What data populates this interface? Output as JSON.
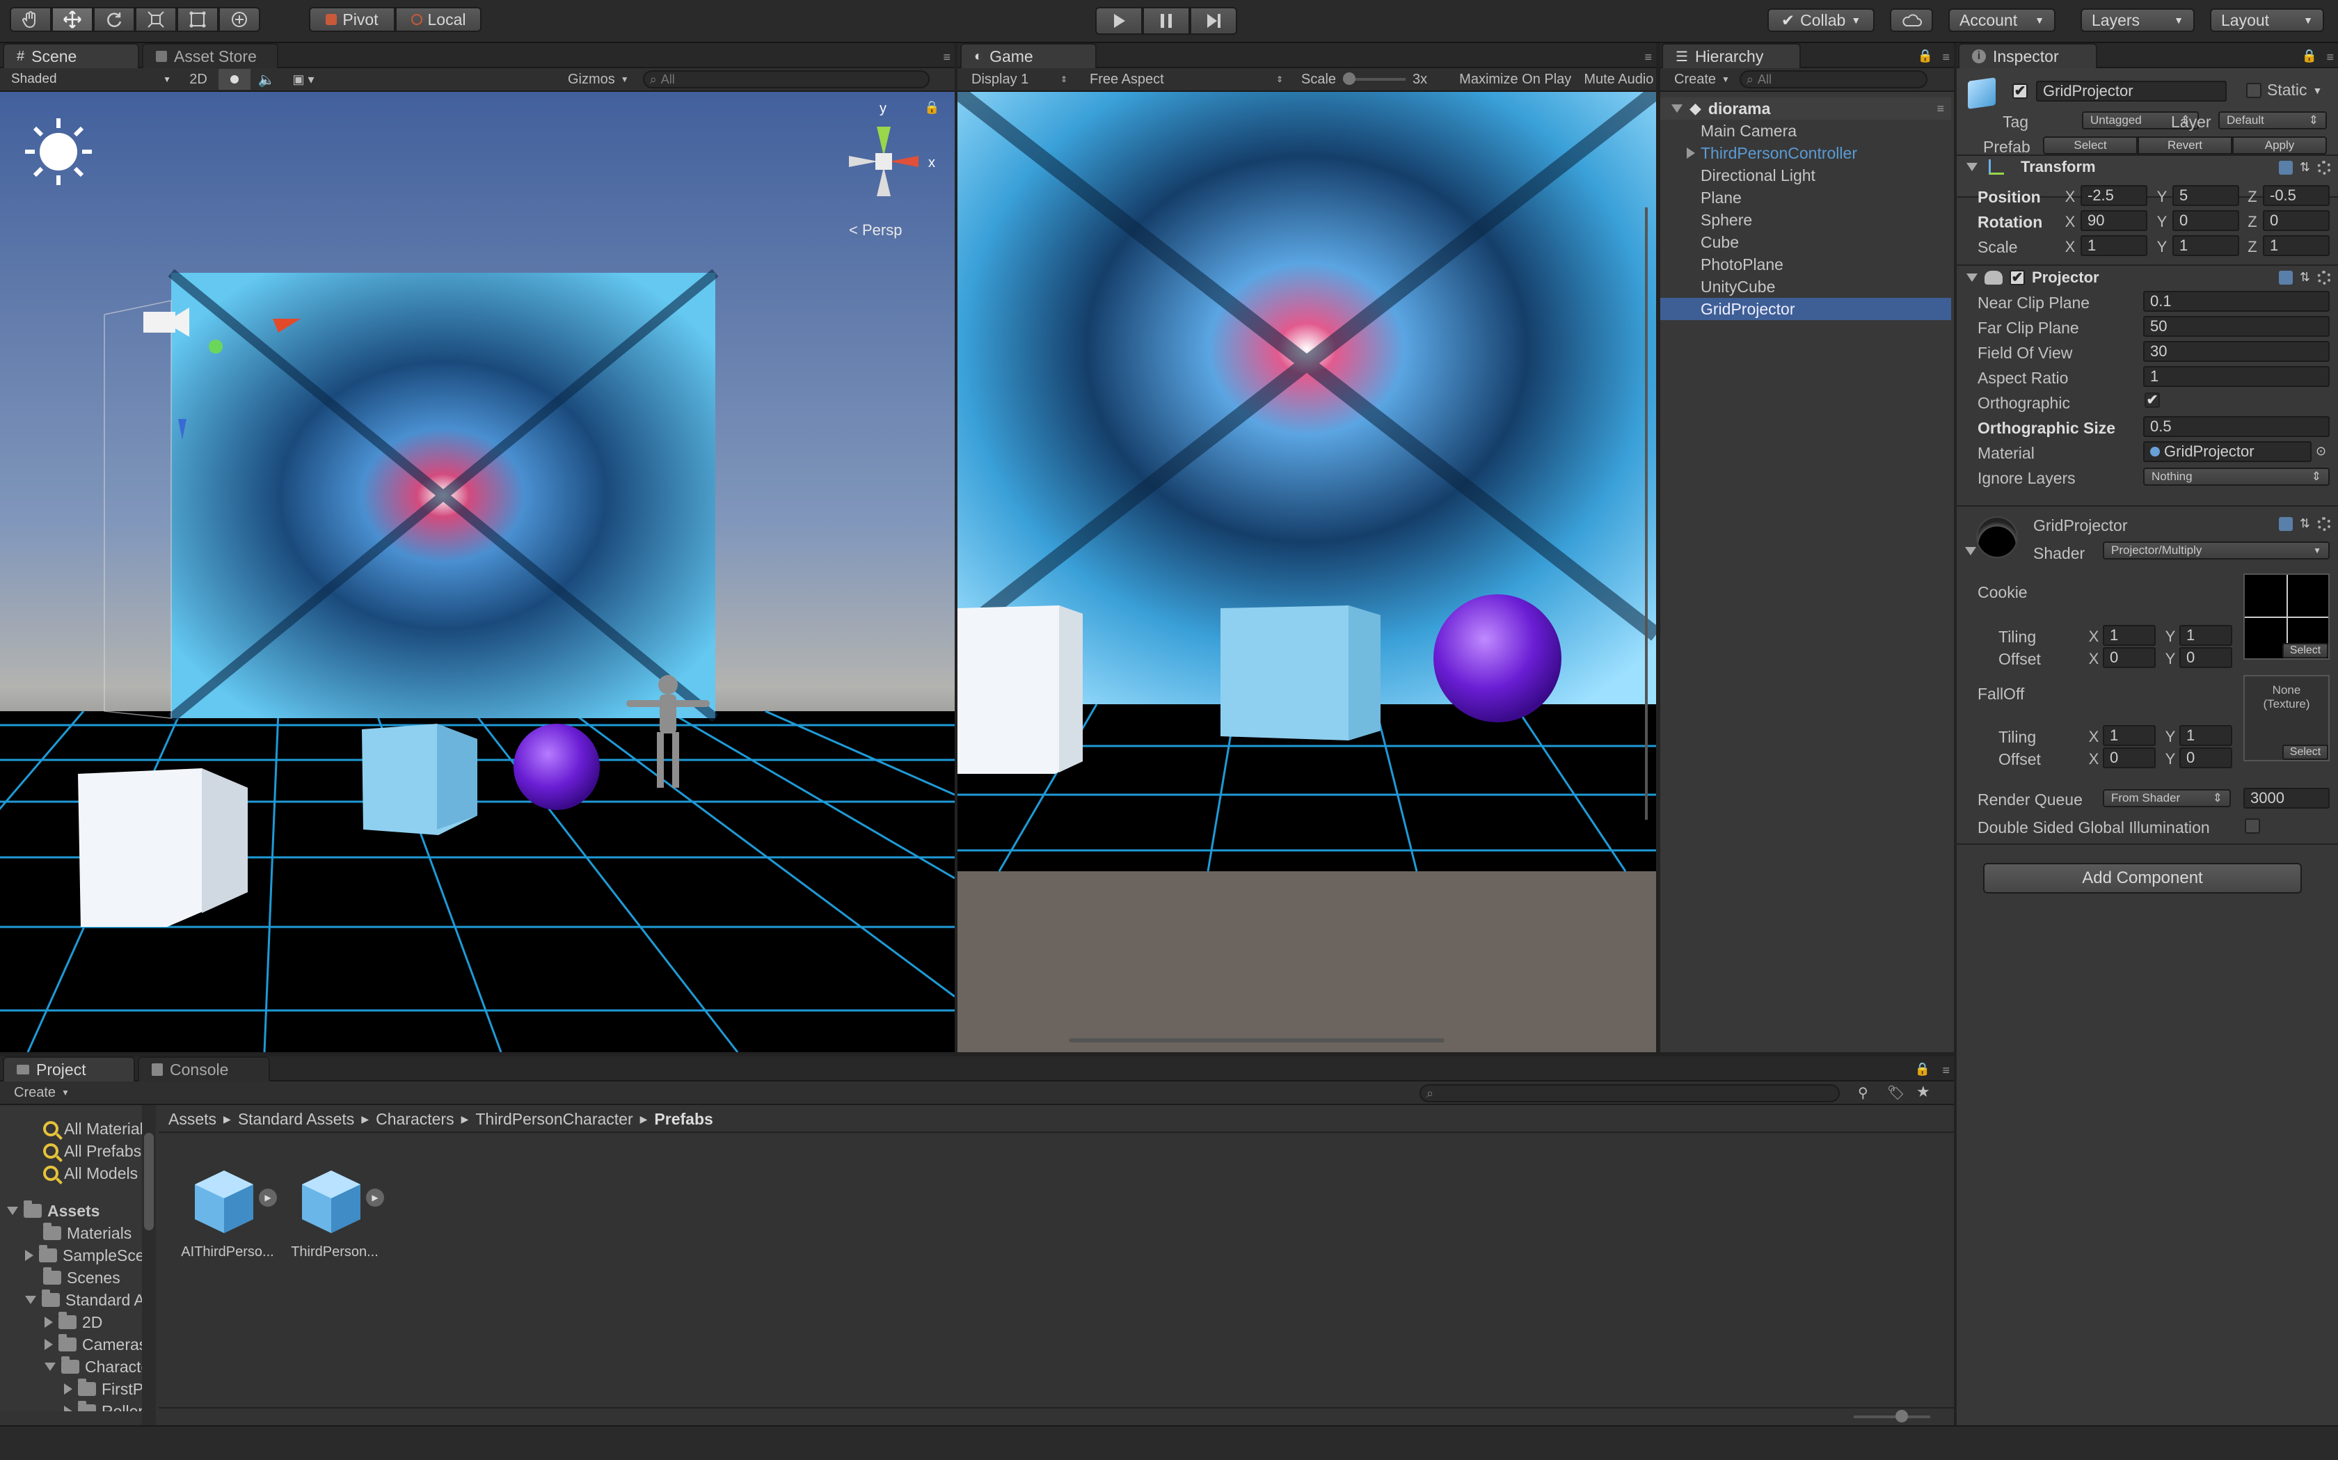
{
  "toolbar": {
    "pivot": "Pivot",
    "local": "Local",
    "collab": "Collab",
    "account": "Account",
    "layers": "Layers",
    "layout": "Layout"
  },
  "scene": {
    "tab": "Scene",
    "asset_store_tab": "Asset Store",
    "shading": "Shaded",
    "mode_2d": "2D",
    "gizmos": "Gizmos",
    "search_placeholder": "All",
    "persp_label": "Persp",
    "gizmo_x": "x",
    "gizmo_y": "y"
  },
  "game": {
    "tab": "Game",
    "display": "Display 1",
    "aspect": "Free Aspect",
    "scale_label": "Scale",
    "scale_value": "3x",
    "maximize": "Maximize On Play",
    "mute": "Mute Audio"
  },
  "hierarchy": {
    "tab": "Hierarchy",
    "create": "Create",
    "search_placeholder": "All",
    "scene_name": "diorama",
    "items": [
      "Main Camera",
      "ThirdPersonController",
      "Directional Light",
      "Plane",
      "Sphere",
      "Cube",
      "PhotoPlane",
      "UnityCube",
      "GridProjector"
    ],
    "selected": "GridProjector"
  },
  "inspector": {
    "tab": "Inspector",
    "object_name": "GridProjector",
    "static_label": "Static",
    "tag_label": "Tag",
    "tag_value": "Untagged",
    "layer_label": "Layer",
    "layer_value": "Default",
    "prefab_label": "Prefab",
    "prefab_select": "Select",
    "prefab_revert": "Revert",
    "prefab_apply": "Apply",
    "transform": {
      "title": "Transform",
      "position_label": "Position",
      "rotation_label": "Rotation",
      "scale_label": "Scale",
      "position": {
        "x": "-2.5",
        "y": "5",
        "z": "-0.5"
      },
      "rotation": {
        "x": "90",
        "y": "0",
        "z": "0"
      },
      "scale": {
        "x": "1",
        "y": "1",
        "z": "1"
      }
    },
    "projector": {
      "title": "Projector",
      "near_label": "Near Clip Plane",
      "near": "0.1",
      "far_label": "Far Clip Plane",
      "far": "50",
      "fov_label": "Field Of View",
      "fov": "30",
      "aspect_label": "Aspect Ratio",
      "aspect": "1",
      "ortho_label": "Orthographic",
      "ortho_size_label": "Orthographic Size",
      "ortho_size": "0.5",
      "material_label": "Material",
      "material": "GridProjector",
      "ignore_label": "Ignore Layers",
      "ignore": "Nothing"
    },
    "material": {
      "name": "GridProjector",
      "shader_label": "Shader",
      "shader": "Projector/Multiply",
      "cookie_label": "Cookie",
      "falloff_label": "FallOff",
      "tiling_label": "Tiling",
      "offset_label": "Offset",
      "cookie_tiling": {
        "x": "1",
        "y": "1"
      },
      "cookie_offset": {
        "x": "0",
        "y": "0"
      },
      "falloff_tiling": {
        "x": "1",
        "y": "1"
      },
      "falloff_offset": {
        "x": "0",
        "y": "0"
      },
      "select": "Select",
      "falloff_none": "None",
      "falloff_type": "(Texture)",
      "render_queue_label": "Render Queue",
      "render_queue_mode": "From Shader",
      "render_queue": "3000",
      "dsgi_label": "Double Sided Global Illumination"
    },
    "add_component": "Add Component",
    "axis_x": "X",
    "axis_y": "Y",
    "axis_z": "Z"
  },
  "project": {
    "tab": "Project",
    "console_tab": "Console",
    "create": "Create",
    "breadcrumb": [
      "Assets",
      "Standard Assets",
      "Characters",
      "ThirdPersonCharacter",
      "Prefabs"
    ],
    "favorites": [
      "All Materials",
      "All Prefabs",
      "All Models"
    ],
    "tree": [
      {
        "label": "Assets",
        "level": 0,
        "arrow": "down"
      },
      {
        "label": "Materials",
        "level": 1,
        "arrow": "none"
      },
      {
        "label": "SampleScenes",
        "level": 1,
        "arrow": "right"
      },
      {
        "label": "Scenes",
        "level": 1,
        "arrow": "none"
      },
      {
        "label": "Standard Assets",
        "level": 1,
        "arrow": "down"
      },
      {
        "label": "2D",
        "level": 2,
        "arrow": "right"
      },
      {
        "label": "Cameras",
        "level": 2,
        "arrow": "right"
      },
      {
        "label": "Characters",
        "level": 2,
        "arrow": "down"
      },
      {
        "label": "FirstPersonCharacter",
        "level": 3,
        "arrow": "right"
      },
      {
        "label": "RollerBall",
        "level": 3,
        "arrow": "right"
      }
    ],
    "assets": [
      "AIThirdPerso...",
      "ThirdPerson..."
    ]
  },
  "colors": {
    "accent": "#3e5f96",
    "link": "#5b9bd5",
    "grid": "#1f9ad6",
    "sphere": "#7a2ee0",
    "cube": "#8fd0f0"
  }
}
